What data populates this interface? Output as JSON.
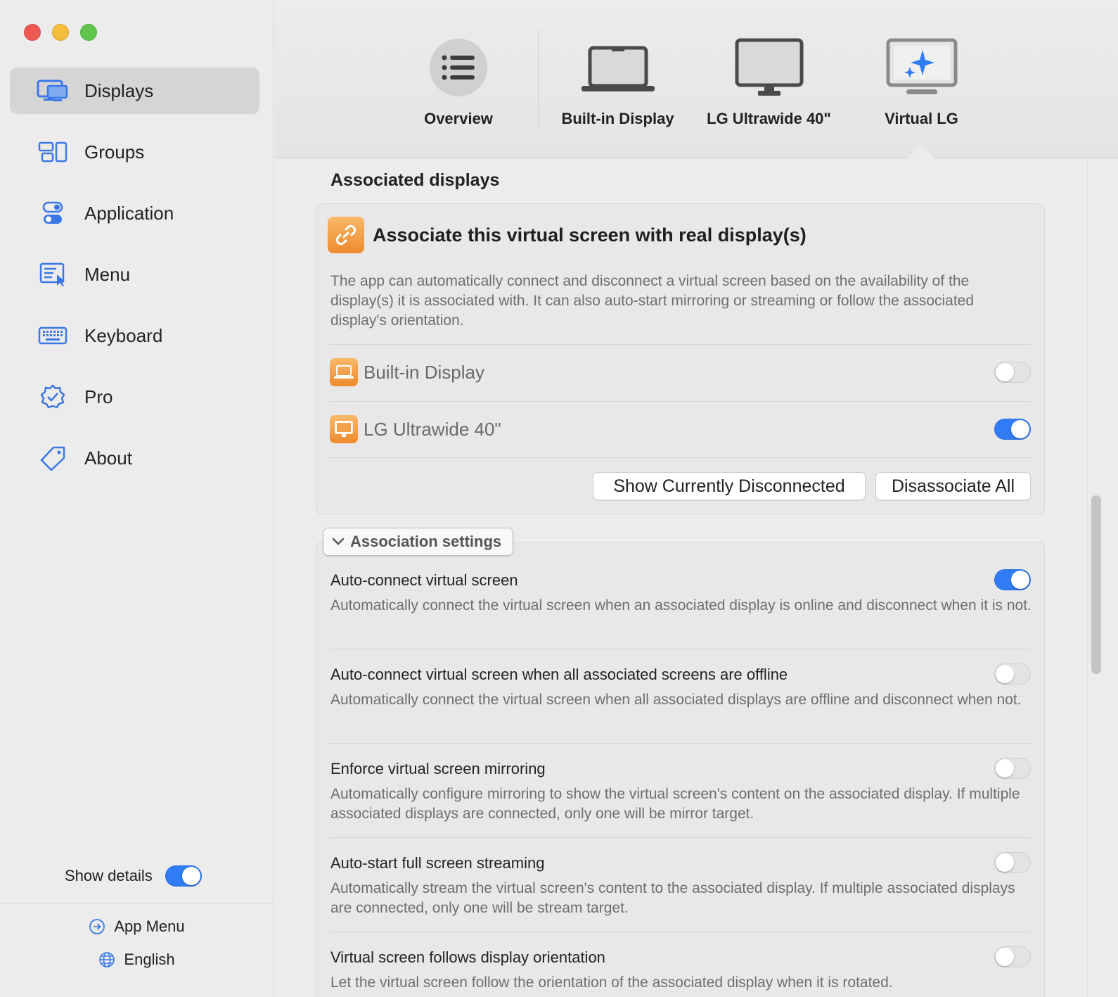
{
  "window": {
    "controls": [
      "close",
      "minimize",
      "zoom"
    ]
  },
  "sidebar": {
    "items": [
      {
        "label": "Displays",
        "icon": "displays-icon",
        "active": true
      },
      {
        "label": "Groups",
        "icon": "groups-icon",
        "active": false
      },
      {
        "label": "Application",
        "icon": "application-icon",
        "active": false
      },
      {
        "label": "Menu",
        "icon": "menu-icon",
        "active": false
      },
      {
        "label": "Keyboard",
        "icon": "keyboard-icon",
        "active": false
      },
      {
        "label": "Pro",
        "icon": "pro-badge-icon",
        "active": false
      },
      {
        "label": "About",
        "icon": "tag-icon",
        "active": false
      }
    ],
    "show_details_label": "Show details",
    "show_details_on": true,
    "footer": {
      "app_menu": "App Menu",
      "language": "English"
    }
  },
  "toolbar": {
    "tabs": [
      {
        "label": "Overview",
        "icon": "list-icon"
      },
      {
        "label": "Built-in Display",
        "icon": "laptop-icon"
      },
      {
        "label": "LG Ultrawide 40\"",
        "icon": "monitor-icon"
      },
      {
        "label": "Virtual LG",
        "icon": "virtual-monitor-icon",
        "selected": true
      }
    ]
  },
  "associated": {
    "section_title": "Associated displays",
    "card_title": "Associate this virtual screen with real display(s)",
    "description": "The app can automatically connect and disconnect a virtual screen based on the availability of the display(s) it is associated with. It can also auto-start mirroring or streaming or follow the associated display's orientation.",
    "displays": [
      {
        "name": "Built-in Display",
        "icon": "laptop-icon",
        "enabled": false
      },
      {
        "name": "LG Ultrawide 40\"",
        "icon": "monitor-icon",
        "enabled": true
      }
    ],
    "buttons": {
      "show_disconnected": "Show Currently Disconnected",
      "disassociate_all": "Disassociate All"
    }
  },
  "association_settings": {
    "disclosure_label": "Association settings",
    "settings": [
      {
        "title": "Auto-connect virtual screen",
        "description": "Automatically connect the virtual screen when an associated display is online and disconnect when it is not.",
        "enabled": true
      },
      {
        "title": "Auto-connect virtual screen when all associated screens are offline",
        "description": "Automatically connect the virtual screen when all associated displays are offline and disconnect when not.",
        "enabled": false
      },
      {
        "title": "Enforce virtual screen mirroring",
        "description": "Automatically configure mirroring to show the virtual screen's content on the associated display. If multiple associated displays are connected, only one will be mirror target.",
        "enabled": false
      },
      {
        "title": "Auto-start full screen streaming",
        "description": "Automatically stream the virtual screen's content to the associated display. If multiple associated displays are connected, only one will be stream target.",
        "enabled": false
      },
      {
        "title": "Virtual screen follows display orientation",
        "description": "Let the virtual screen follow the orientation of the associated display when it is rotated.",
        "enabled": false
      }
    ]
  },
  "colors": {
    "accent": "#2f7cf6",
    "orange": "#ef8a2e",
    "sidebar_active": "#d5d5d5"
  }
}
